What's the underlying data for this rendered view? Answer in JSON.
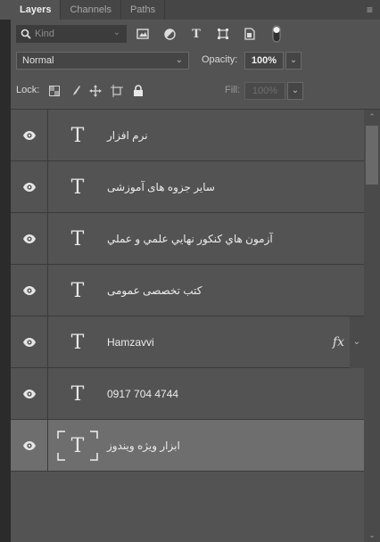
{
  "tabs": [
    {
      "label": "Layers",
      "active": true
    },
    {
      "label": "Channels",
      "active": false
    },
    {
      "label": "Paths",
      "active": false
    }
  ],
  "filter": {
    "kind_placeholder": "Kind",
    "icons": [
      "search-icon",
      "image-filter-icon",
      "adjustment-filter-icon",
      "type-filter-icon",
      "shape-filter-icon",
      "smart-object-filter-icon",
      "filter-toggle-icon"
    ]
  },
  "blend": {
    "mode": "Normal",
    "opacity_label": "Opacity:",
    "opacity_value": "100%"
  },
  "lock": {
    "label": "Lock:",
    "icons": [
      "lock-transparent-icon",
      "lock-image-icon",
      "lock-position-icon",
      "lock-artboard-icon",
      "lock-all-icon"
    ],
    "fill_label": "Fill:",
    "fill_value": "100%"
  },
  "layers": [
    {
      "name": "نرم افزار",
      "type": "T",
      "visible": true,
      "fx": false,
      "selected": false
    },
    {
      "name": "سایر جزوه های آموزشی",
      "type": "T",
      "visible": true,
      "fx": false,
      "selected": false
    },
    {
      "name": "آزمون هاي كنكور نهايي علمي و عملي",
      "type": "T",
      "visible": true,
      "fx": false,
      "selected": false
    },
    {
      "name": "کتب تخصصی عمومی",
      "type": "T",
      "visible": true,
      "fx": false,
      "selected": false
    },
    {
      "name": "Hamzavvi",
      "type": "T",
      "visible": true,
      "fx": true,
      "selected": false
    },
    {
      "name": "0917 704 4744",
      "type": "T",
      "visible": true,
      "fx": false,
      "selected": false
    },
    {
      "name": "ابزار ویژه ویندوز",
      "type": "T",
      "visible": true,
      "fx": false,
      "selected": true
    }
  ],
  "colors": {
    "panel_bg": "#535353",
    "selected_row": "#6e6e6e",
    "field_bg": "#454545"
  }
}
